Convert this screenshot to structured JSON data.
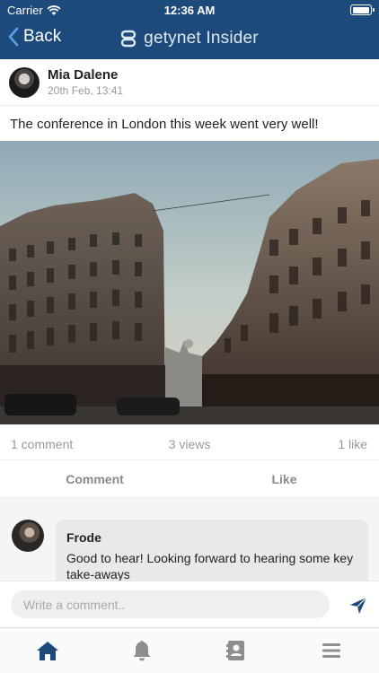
{
  "status_bar": {
    "carrier": "Carrier",
    "time": "12:36 AM",
    "battery_level": 0.95
  },
  "nav": {
    "back_label": "Back",
    "title": "getynet Insider"
  },
  "post": {
    "author": "Mia Dalene",
    "date": "20th Feb, 13:41",
    "text": "The conference in London this week went very well!",
    "image_alt": "London street with buildings"
  },
  "stats": {
    "comments": "1 comment",
    "views": "3 views",
    "likes": "1 like"
  },
  "actions": {
    "comment_label": "Comment",
    "like_label": "Like"
  },
  "comments": [
    {
      "author": "Frode",
      "text": "Good to hear! Looking forward to hearing some key take-aways"
    }
  ],
  "composer": {
    "placeholder": "Write a comment.."
  },
  "tabbar": {
    "items": [
      {
        "icon": "home-icon",
        "active": true
      },
      {
        "icon": "bell-icon",
        "active": false
      },
      {
        "icon": "contacts-icon",
        "active": false
      },
      {
        "icon": "menu-icon",
        "active": false
      }
    ]
  },
  "colors": {
    "brand": "#1c4a7a",
    "active_tab": "#1c4a7a",
    "inactive_tab": "#8e8e8e"
  }
}
